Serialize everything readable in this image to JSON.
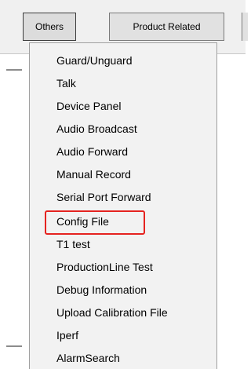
{
  "toolbar": {
    "buttons": [
      {
        "label": "Others"
      },
      {
        "label": "Product Related"
      }
    ]
  },
  "menu": {
    "items": [
      {
        "label": "Guard/Unguard"
      },
      {
        "label": "Talk"
      },
      {
        "label": "Device Panel"
      },
      {
        "label": "Audio Broadcast"
      },
      {
        "label": "Audio Forward"
      },
      {
        "label": "Manual Record"
      },
      {
        "label": "Serial Port Forward"
      },
      {
        "label": "Config File"
      },
      {
        "label": "T1 test"
      },
      {
        "label": "ProductionLine Test"
      },
      {
        "label": "Debug Information"
      },
      {
        "label": "Upload Calibration File"
      },
      {
        "label": "Iperf"
      },
      {
        "label": "AlarmSearch"
      }
    ],
    "highlighted_item": "Config File",
    "highlight_color": "#e52320"
  }
}
